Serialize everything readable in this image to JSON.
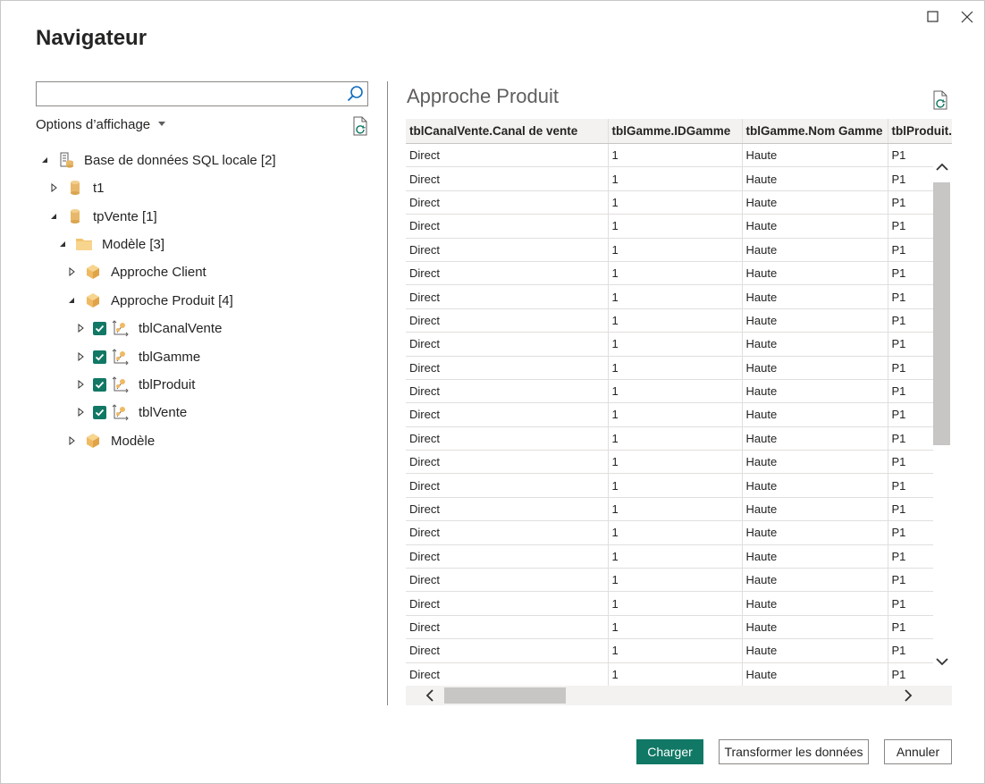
{
  "window": {
    "title": "Navigateur"
  },
  "search": {
    "placeholder": "",
    "value": ""
  },
  "options_label": "Options d’affichage",
  "tree": {
    "database": "Base de données SQL locale [2]",
    "t1": "t1",
    "tpVente": "tpVente [1]",
    "modele_folder": "Modèle [3]",
    "approche_client": "Approche Client",
    "approche_produit": "Approche Produit [4]",
    "tables": [
      "tblCanalVente",
      "tblGamme",
      "tblProduit",
      "tblVente"
    ],
    "modele": "Modèle"
  },
  "preview": {
    "title": "Approche Produit",
    "columns": [
      "tblCanalVente.Canal de vente",
      "tblGamme.IDGamme",
      "tblGamme.Nom Gamme",
      "tblProduit."
    ],
    "rows": [
      [
        "Direct",
        "1",
        "Haute",
        "P1"
      ],
      [
        "Direct",
        "1",
        "Haute",
        "P1"
      ],
      [
        "Direct",
        "1",
        "Haute",
        "P1"
      ],
      [
        "Direct",
        "1",
        "Haute",
        "P1"
      ],
      [
        "Direct",
        "1",
        "Haute",
        "P1"
      ],
      [
        "Direct",
        "1",
        "Haute",
        "P1"
      ],
      [
        "Direct",
        "1",
        "Haute",
        "P1"
      ],
      [
        "Direct",
        "1",
        "Haute",
        "P1"
      ],
      [
        "Direct",
        "1",
        "Haute",
        "P1"
      ],
      [
        "Direct",
        "1",
        "Haute",
        "P1"
      ],
      [
        "Direct",
        "1",
        "Haute",
        "P1"
      ],
      [
        "Direct",
        "1",
        "Haute",
        "P1"
      ],
      [
        "Direct",
        "1",
        "Haute",
        "P1"
      ],
      [
        "Direct",
        "1",
        "Haute",
        "P1"
      ],
      [
        "Direct",
        "1",
        "Haute",
        "P1"
      ],
      [
        "Direct",
        "1",
        "Haute",
        "P1"
      ],
      [
        "Direct",
        "1",
        "Haute",
        "P1"
      ],
      [
        "Direct",
        "1",
        "Haute",
        "P1"
      ],
      [
        "Direct",
        "1",
        "Haute",
        "P1"
      ],
      [
        "Direct",
        "1",
        "Haute",
        "P1"
      ],
      [
        "Direct",
        "1",
        "Haute",
        "P1"
      ],
      [
        "Direct",
        "1",
        "Haute",
        "P1"
      ],
      [
        "Direct",
        "1",
        "Haute",
        "P1"
      ]
    ]
  },
  "buttons": {
    "load": "Charger",
    "transform": "Transformer les données",
    "cancel": "Annuler"
  },
  "colors": {
    "accent": "#117865",
    "folder": "#f2c46d",
    "database": "#e8b86a",
    "cube": "#f0b963"
  },
  "icons": {
    "maximize": "maximize-icon",
    "close": "close-icon",
    "search": "search-icon",
    "refresh": "refresh-icon",
    "database": "database-server-icon",
    "cylinder": "database-icon",
    "folder": "folder-icon",
    "cube": "cube-icon",
    "table": "table-icon",
    "check": "checkbox-checked-icon"
  }
}
